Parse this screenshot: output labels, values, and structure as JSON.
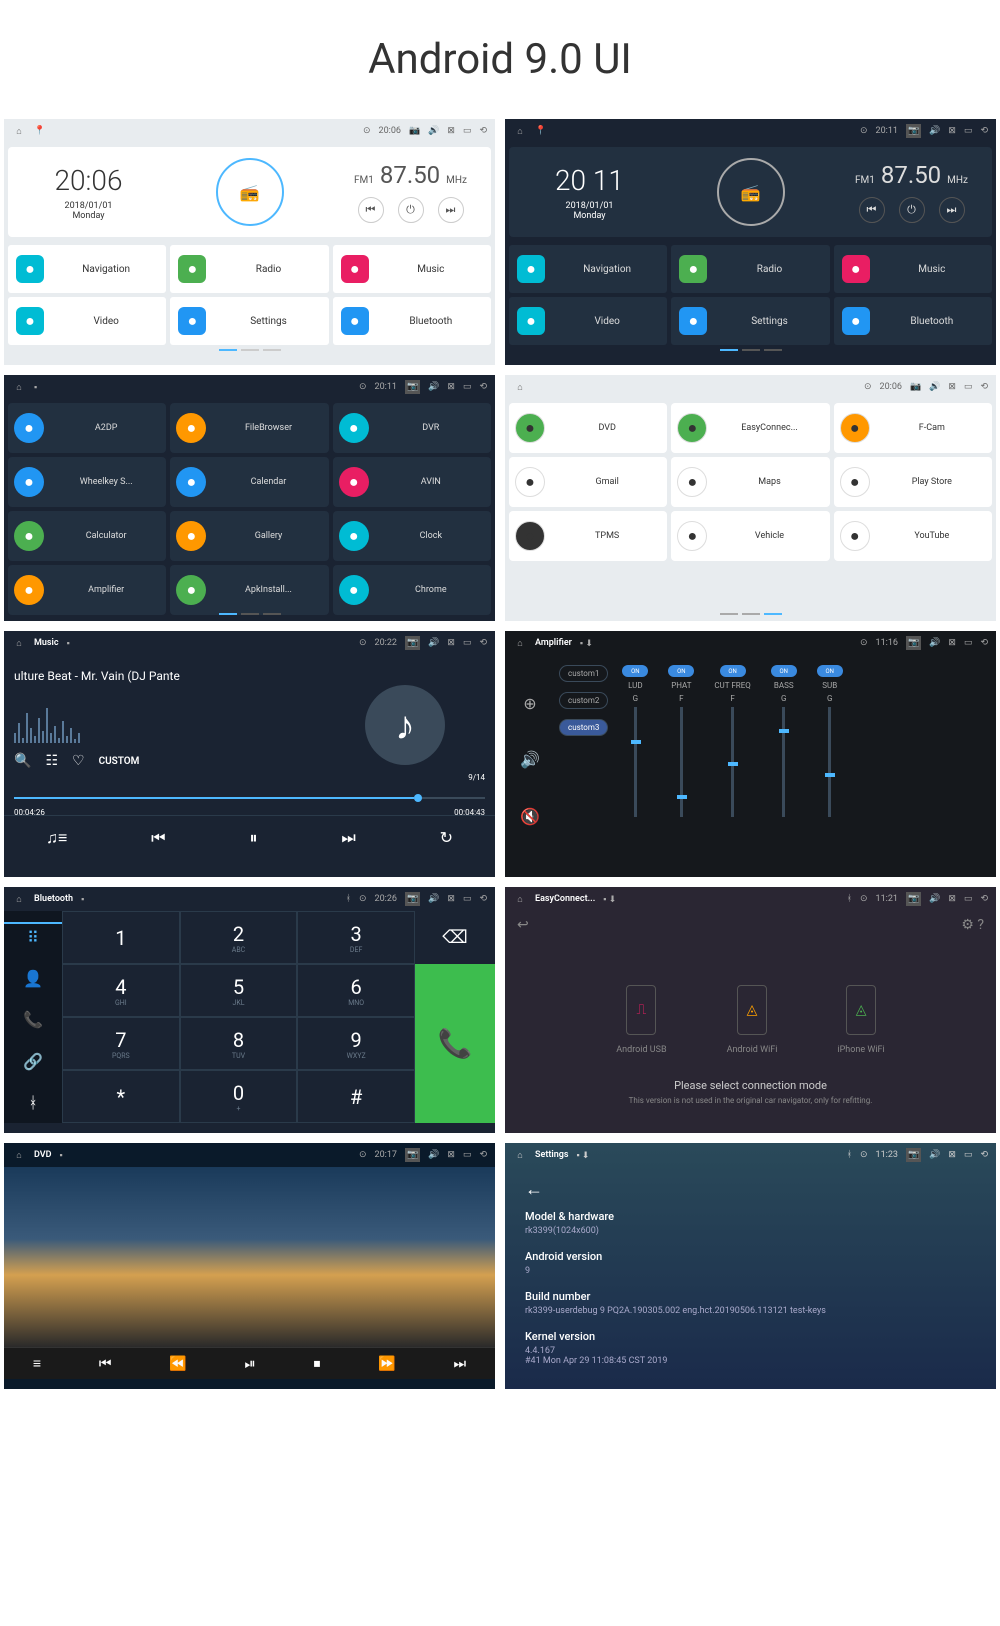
{
  "title": "Android 9.0 UI",
  "s1": {
    "time": "20:06",
    "date": "2018/01/01",
    "day": "Monday",
    "band": "FM1",
    "freq": "87.50",
    "unit": "MHz",
    "apps": [
      "Navigation",
      "Radio",
      "Music",
      "Video",
      "Settings",
      "Bluetooth"
    ],
    "status_time": "20:06"
  },
  "s2": {
    "time": "20 11",
    "date": "2018/01/01",
    "day": "Monday",
    "band": "FM1",
    "freq": "87.50",
    "unit": "MHz",
    "apps": [
      "Navigation",
      "Radio",
      "Music",
      "Video",
      "Settings",
      "Bluetooth"
    ],
    "status_time": "20:11"
  },
  "s3": {
    "status_time": "20:11",
    "apps": [
      "A2DP",
      "FileBrowser",
      "DVR",
      "Wheelkey S...",
      "Calendar",
      "AVIN",
      "Calculator",
      "Gallery",
      "Clock",
      "Amplifier",
      "ApkInstall...",
      "Chrome"
    ]
  },
  "s4": {
    "status_time": "20:06",
    "apps": [
      "DVD",
      "EasyConnec...",
      "F-Cam",
      "Gmail",
      "Maps",
      "Play Store",
      "TPMS",
      "Vehicle",
      "YouTube"
    ]
  },
  "s5": {
    "title": "Music",
    "status_time": "20:22",
    "track": "ulture Beat - Mr. Vain (DJ Pante",
    "custom": "CUSTOM",
    "pos": "9/14",
    "elapsed": "00:04:26",
    "total": "00:04:43"
  },
  "s6": {
    "title": "Amplifier",
    "status_time": "11:16",
    "presets": [
      "custom1",
      "custom2",
      "custom3"
    ],
    "bands": [
      {
        "on": "ON",
        "name": "LUD",
        "val": "G"
      },
      {
        "on": "ON",
        "name": "PHAT",
        "val": "F"
      },
      {
        "on": "ON",
        "name": "CUT FREQ",
        "val": "F"
      },
      {
        "on": "ON",
        "name": "BASS",
        "val": "G"
      },
      {
        "on": "ON",
        "name": "SUB",
        "val": "G"
      }
    ]
  },
  "s7": {
    "title": "Bluetooth",
    "status_time": "20:26",
    "keys": [
      {
        "n": "1",
        "s": ""
      },
      {
        "n": "2",
        "s": "ABC"
      },
      {
        "n": "3",
        "s": "DEF"
      },
      {
        "n": "4",
        "s": "GHI"
      },
      {
        "n": "5",
        "s": "JKL"
      },
      {
        "n": "6",
        "s": "MNO"
      },
      {
        "n": "7",
        "s": "PQRS"
      },
      {
        "n": "8",
        "s": "TUV"
      },
      {
        "n": "9",
        "s": "WXYZ"
      },
      {
        "n": "*",
        "s": ""
      },
      {
        "n": "0",
        "s": "+"
      },
      {
        "n": "#",
        "s": ""
      }
    ]
  },
  "s8": {
    "title": "EasyConnect...",
    "status_time": "11:21",
    "modes": [
      "Android USB",
      "Android WiFi",
      "iPhone WiFi"
    ],
    "msg": "Please select connection mode",
    "sub": "This version is not used in the original car navigator, only for refitting."
  },
  "s9": {
    "title": "DVD",
    "status_time": "20:17"
  },
  "s10": {
    "title": "Settings",
    "status_time": "11:23",
    "items": [
      {
        "k": "Model & hardware",
        "v": "rk3399(1024x600)"
      },
      {
        "k": "Android version",
        "v": "9"
      },
      {
        "k": "Build number",
        "v": "rk3399-userdebug 9 PQ2A.190305.002 eng.hct.20190506.113121 test-keys"
      },
      {
        "k": "Kernel version",
        "v": "4.4.167\n#41 Mon Apr 29 11:08:45 CST 2019"
      }
    ]
  },
  "colors": {
    "s3_icons": [
      "#2196f3",
      "#ff9800",
      "#00bcd4",
      "#2196f3",
      "#2196f3",
      "#e91e63",
      "#4caf50",
      "#ff9800",
      "#00bcd4",
      "#ff9800",
      "#4caf50",
      "#00bcd4"
    ],
    "s4_icons": [
      "#4caf50",
      "#4caf50",
      "#ff9800",
      "#fff",
      "#fff",
      "#fff",
      "#333",
      "#fff",
      "#fff"
    ],
    "home_icons": [
      "#00bcd4",
      "#4caf50",
      "#e91e63",
      "#00bcd4",
      "#2196f3",
      "#2196f3"
    ]
  }
}
